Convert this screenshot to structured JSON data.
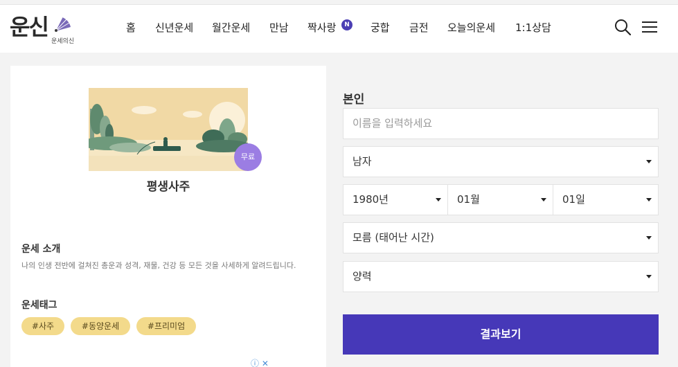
{
  "brand": {
    "logo_text": "운신",
    "logo_sub": "운세의신"
  },
  "nav": {
    "items": [
      "홈",
      "신년운세",
      "월간운세",
      "만남",
      "짝사랑",
      "궁합",
      "금전",
      "오늘의운세",
      "1:1상담"
    ],
    "new_badge": "N"
  },
  "product": {
    "free_badge": "무료",
    "title": "평생사주",
    "intro_heading": "운세 소개",
    "intro_text": "나의 인생 전반에 걸쳐진 총운과 성격, 재물, 건강 등 모든 것을 사세하게 알려드립니다.",
    "tags_heading": "운세태그",
    "tags": [
      "#사주",
      "#동양운세",
      "#프리미엄"
    ]
  },
  "ad": {
    "info_glyph": "ⓘ",
    "close_glyph": "✕"
  },
  "form": {
    "section_title": "본인",
    "name_placeholder": "이름을 입력하세요",
    "gender": "남자",
    "year": "1980년",
    "month": "01월",
    "day": "01일",
    "birth_time": "모름 (태어난 시간)",
    "calendar": "양력",
    "submit_label": "결과보기"
  },
  "colors": {
    "accent": "#4638b8",
    "badge": "#9b7de3",
    "tag_bg": "#f3da8b"
  },
  "icons": [
    "search-icon",
    "menu-icon",
    "fan-icon",
    "caret-down-icon",
    "info-icon",
    "close-icon"
  ]
}
